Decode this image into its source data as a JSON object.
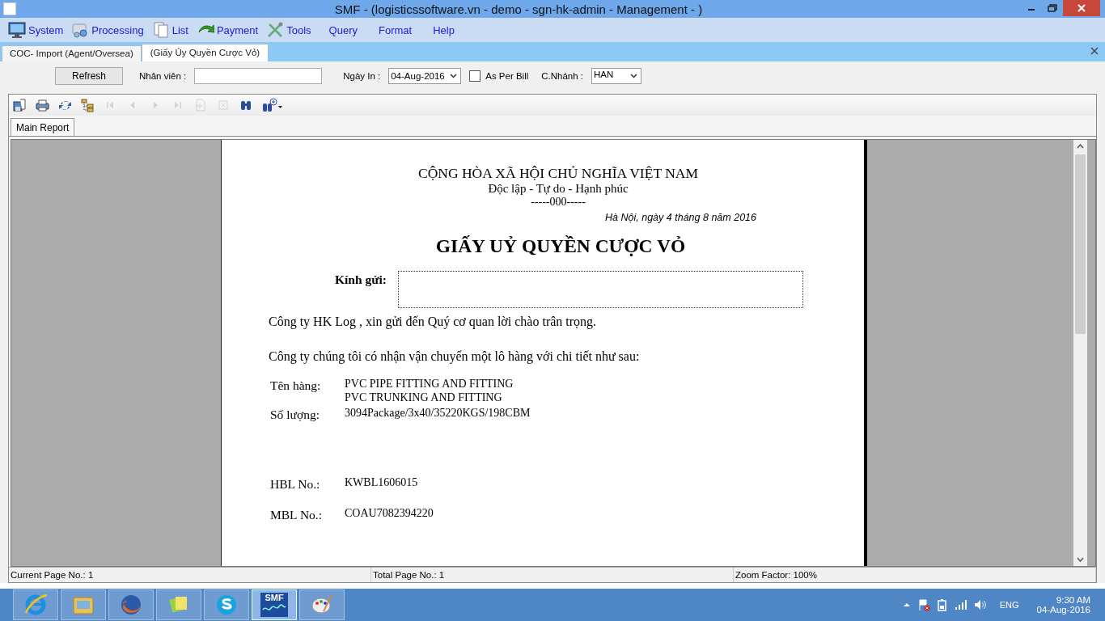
{
  "window": {
    "title": "SMF - (logisticssoftware.vn - demo - sgn-hk-admin - Management - )"
  },
  "menu": [
    {
      "kind": "monitor",
      "label": "System"
    },
    {
      "kind": "gears",
      "label": "Processing"
    },
    {
      "kind": "pages",
      "label": "List"
    },
    {
      "kind": "arrow",
      "label": "Payment"
    },
    {
      "kind": "tools",
      "label": "Tools"
    },
    {
      "kind": "none",
      "label": "Query"
    },
    {
      "kind": "none",
      "label": "Format"
    },
    {
      "kind": "none",
      "label": "Help"
    }
  ],
  "tabs": [
    {
      "label": "COC- Import (Agent/Oversea)",
      "selected": false
    },
    {
      "label": "(Giấy Ủy Quyền Cược Vỏ)",
      "selected": true
    }
  ],
  "filters": {
    "refresh": "Refresh",
    "staff_label": "Nhân viên :",
    "date_label": "Ngày In :",
    "date_value": "04-Aug-2016",
    "as_per_bill": {
      "label": "As Per Bill",
      "checked": false
    },
    "branch_label": "C.Nhánh :",
    "branch_value": "HAN"
  },
  "toolbar": [
    {
      "kind": "export",
      "disabled": false
    },
    {
      "kind": "print",
      "disabled": false
    },
    {
      "kind": "refresh",
      "disabled": false
    },
    {
      "kind": "tree",
      "disabled": false
    },
    {
      "kind": "first",
      "disabled": true
    },
    {
      "kind": "prev",
      "disabled": true
    },
    {
      "kind": "next",
      "disabled": true
    },
    {
      "kind": "last",
      "disabled": true
    },
    {
      "kind": "goto",
      "disabled": true
    },
    {
      "kind": "stop",
      "disabled": true
    },
    {
      "kind": "search",
      "disabled": false
    },
    {
      "kind": "zoom",
      "disabled": false
    }
  ],
  "report_tabs": [
    {
      "label": "Main Report",
      "selected": true
    }
  ],
  "document": {
    "nation": "CỘNG HÒA XÃ HỘI CHỦ NGHĨA VIỆT NAM",
    "motto": "Độc lập  - Tự do -  Hạnh phúc",
    "separator": "-----000-----",
    "date_line": "Hà Nội, ngày 4 tháng 8 năm 2016",
    "title": "GIẤY UỶ QUYỀN CƯỢC VỎ",
    "recipient_label": "Kính gửi:",
    "greeting": "Công ty HK Log , xin gửi đến Quý cơ quan lời chào trân trọng.",
    "intro": "Công ty chúng tôi có nhận vận chuyển một lô hàng với chi tiết như sau:",
    "details": [
      {
        "label": "Tên hàng:",
        "values": [
          "PVC PIPE FITTING AND FITTING",
          "PVC TRUNKING AND FITTING"
        ]
      },
      {
        "label": "Số lượng:",
        "values": [
          "3094Package/3x40/35220KGS/198CBM"
        ]
      },
      {
        "label": "HBL No.:",
        "values": [
          "KWBL1606015"
        ]
      },
      {
        "label": "MBL No.:",
        "values": [
          "COAU7082394220"
        ]
      }
    ]
  },
  "status_bar": [
    "Current Page No.: 1",
    "Total Page No.: 1",
    "Zoom Factor: 100%"
  ],
  "taskbar": {
    "apps": [
      {
        "kind": "ie",
        "selected": false
      },
      {
        "kind": "folder",
        "selected": false
      },
      {
        "kind": "firefox",
        "selected": false
      },
      {
        "kind": "notes",
        "selected": false
      },
      {
        "kind": "skype",
        "selected": false
      },
      {
        "kind": "smf",
        "label": "SMF",
        "selected": true
      },
      {
        "kind": "paint",
        "selected": false
      }
    ],
    "lang": "ENG",
    "time": "9:30 AM",
    "date": "04-Aug-2016"
  }
}
